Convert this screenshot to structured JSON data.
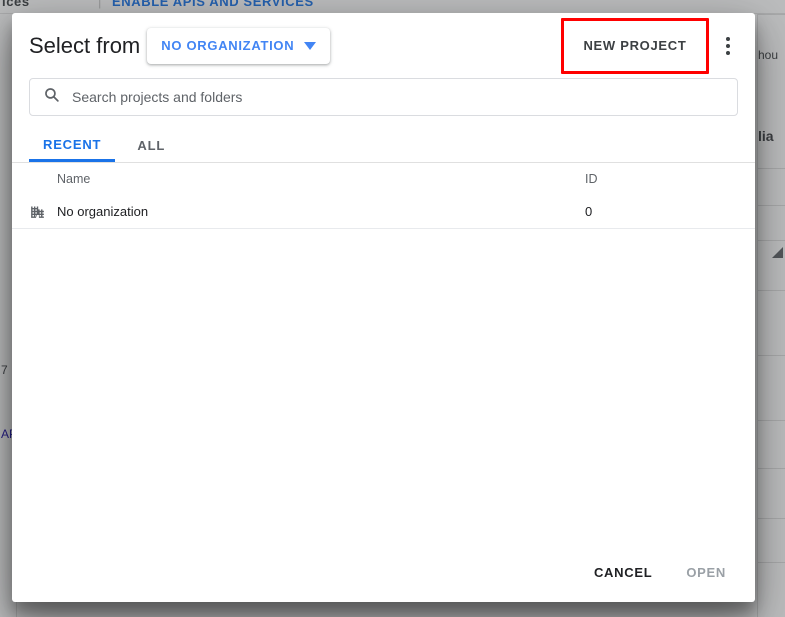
{
  "background": {
    "topbar": {
      "left_text": "ices",
      "separator": "|",
      "action_link": "ENABLE APIS AND SERVICES"
    },
    "left_column": {
      "fragment_1": "7",
      "fragment_2": "AP"
    },
    "right_column": {
      "fragment_1": "hou",
      "fragment_2": "lia"
    },
    "sort_arrow_icon": "triangle-up-icon"
  },
  "dialog": {
    "header": {
      "title": "Select from",
      "org_chip": {
        "label": "NO ORGANIZATION",
        "caret_icon": "chevron-down-icon"
      },
      "new_project_label": "NEW PROJECT",
      "new_project_highlight_color": "#ff0000",
      "kebab_icon": "more-vert-icon"
    },
    "search": {
      "icon": "search-icon",
      "placeholder": "Search projects and folders",
      "value": ""
    },
    "tabs": [
      {
        "label": "RECENT",
        "active": true
      },
      {
        "label": "ALL",
        "active": false
      }
    ],
    "table": {
      "columns": {
        "name": "Name",
        "id": "ID"
      },
      "rows": [
        {
          "icon": "organization-building-icon",
          "name": "No organization",
          "id": "0"
        }
      ]
    },
    "footer": {
      "cancel_label": "CANCEL",
      "open_label": "OPEN",
      "open_disabled": true
    }
  },
  "colors": {
    "accent_blue": "#1a73e8",
    "chip_blue": "#4285f4",
    "highlight_red": "#ff0000",
    "text_primary": "#202124",
    "text_secondary": "#5f6368",
    "disabled": "#9aa0a6"
  }
}
